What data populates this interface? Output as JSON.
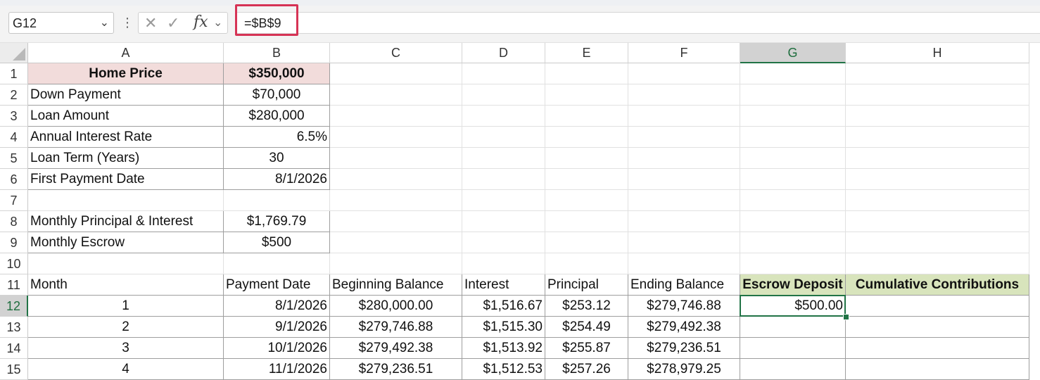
{
  "name_box": {
    "value": "G12"
  },
  "formula_bar": {
    "dots": "⋮",
    "cancel_icon": "✕",
    "enter_icon": "✓",
    "fx_label": "fx",
    "formula": "=$B$9"
  },
  "columns": [
    "A",
    "B",
    "C",
    "D",
    "E",
    "F",
    "G",
    "H"
  ],
  "selected_cell": "G12",
  "rows": [
    {
      "n": "1",
      "A": "Home Price",
      "B": "$350,000"
    },
    {
      "n": "2",
      "A": "Down Payment",
      "B": "$70,000"
    },
    {
      "n": "3",
      "A": "Loan Amount",
      "B": "$280,000"
    },
    {
      "n": "4",
      "A": "Annual Interest Rate",
      "B": "6.5%"
    },
    {
      "n": "5",
      "A": "Loan Term (Years)",
      "B": "30"
    },
    {
      "n": "6",
      "A": "First Payment Date",
      "B": "8/1/2026"
    },
    {
      "n": "7"
    },
    {
      "n": "8",
      "A": "Monthly Principal & Interest",
      "B": "$1,769.79"
    },
    {
      "n": "9",
      "A": "Monthly Escrow",
      "B": "$500"
    },
    {
      "n": "10"
    },
    {
      "n": "11",
      "A": "Month",
      "B": "Payment Date",
      "C": "Beginning Balance",
      "D": "Interest",
      "E": "Principal",
      "F": "Ending Balance",
      "G": "Escrow Deposit",
      "H": "Cumulative Contributions"
    },
    {
      "n": "12",
      "A": "1",
      "B": "8/1/2026",
      "C": "$280,000.00",
      "D": "$1,516.67",
      "E": "$253.12",
      "F": "$279,746.88",
      "G": "$500.00",
      "H": ""
    },
    {
      "n": "13",
      "A": "2",
      "B": "9/1/2026",
      "C": "$279,746.88",
      "D": "$1,515.30",
      "E": "$254.49",
      "F": "$279,492.38",
      "G": "",
      "H": ""
    },
    {
      "n": "14",
      "A": "3",
      "B": "10/1/2026",
      "C": "$279,492.38",
      "D": "$1,513.92",
      "E": "$255.87",
      "F": "$279,236.51",
      "G": "",
      "H": ""
    },
    {
      "n": "15",
      "A": "4",
      "B": "11/1/2026",
      "C": "$279,236.51",
      "D": "$1,512.53",
      "E": "$257.26",
      "F": "$278,979.25",
      "G": "",
      "H": ""
    }
  ]
}
